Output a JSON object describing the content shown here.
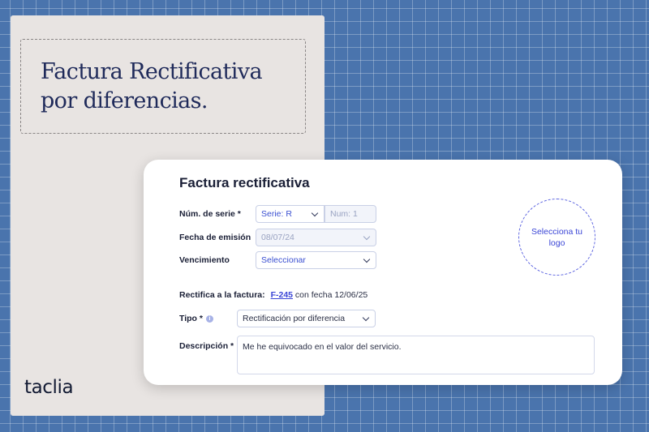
{
  "panel": {
    "headline_line1": "Factura Rectificativa",
    "headline_line2": "por diferencias.",
    "brand": "taclia"
  },
  "form": {
    "title": "Factura rectificativa",
    "serie_label": "Núm. de serie *",
    "serie_value": "Serie: R",
    "num_placeholder": "Num: 1",
    "fecha_label": "Fecha de emisión",
    "fecha_value": "08/07/24",
    "vencimiento_label": "Vencimiento",
    "vencimiento_value": "Seleccionar",
    "logo_text": "Selecciona tu logo",
    "rectifica_label": "Rectifica a la factura:",
    "invoice_ref": "F-245",
    "invoice_date_text": "con fecha 12/06/25",
    "tipo_label": "Tipo *",
    "tipo_value": "Rectificación por diferencia",
    "descripcion_label": "Descripción *",
    "descripcion_value": "Me he equivocado en el valor del servicio."
  },
  "colors": {
    "background": "#4a74ad",
    "accent": "#3a45d6",
    "panel": "#e8e4e2"
  }
}
